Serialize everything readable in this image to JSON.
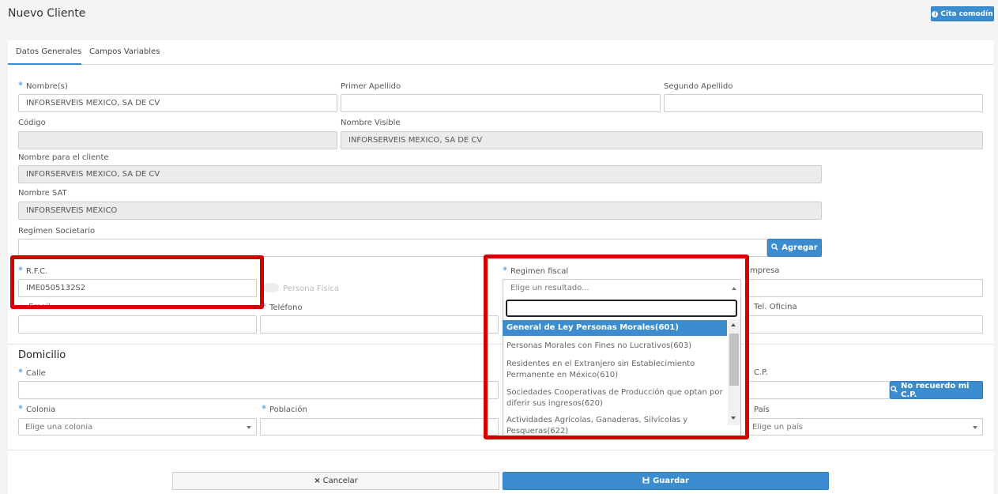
{
  "header": {
    "title": "Nuevo Cliente",
    "cita_label": "Cita comodín"
  },
  "tabs": [
    {
      "label": "Datos Generales",
      "active": true
    },
    {
      "label": "Campos Variables",
      "active": false
    }
  ],
  "fields": {
    "nombre": {
      "label": "Nombre(s)",
      "value": "INFORSERVEIS MEXICO, SA DE CV"
    },
    "primer_apellido": {
      "label": "Primer Apellido",
      "value": ""
    },
    "segundo_apellido": {
      "label": "Segundo Apellido",
      "value": ""
    },
    "codigo": {
      "label": "Código",
      "value": ""
    },
    "nombre_visible": {
      "label": "Nombre Visible",
      "value": "INFORSERVEIS MEXICO, SA DE CV"
    },
    "nombre_cliente": {
      "label": "Nombre para el cliente",
      "value": "INFORSERVEIS MEXICO, SA DE CV"
    },
    "nombre_sat": {
      "label": "Nombre SAT",
      "value": "INFORSERVEIS MEXICO"
    },
    "regimen_societario": {
      "label": "Regímen Societario",
      "value": "",
      "button": "Agregar"
    },
    "rfc": {
      "label": "R.F.C.",
      "value": "IME0505132S2"
    },
    "persona_fisica": {
      "label": "Persona Física"
    },
    "regimen_fiscal": {
      "label": "Regimen fiscal",
      "placeholder": "Elige un resultado..."
    },
    "empresa": {
      "label_fragment": "mpresa",
      "value": ""
    },
    "email": {
      "label_fragment": "Email",
      "value": ""
    },
    "telefono": {
      "label": "Teléfono",
      "value": ""
    },
    "tel_oficina": {
      "label": "Tel. Oficina",
      "value": ""
    }
  },
  "domicilio": {
    "title": "Domicilio",
    "calle": {
      "label": "Calle",
      "value": ""
    },
    "cp": {
      "label": "C.P.",
      "button": "No recuerdo mi C.P."
    },
    "colonia": {
      "label": "Colonia",
      "placeholder": "Elige una colonia"
    },
    "poblacion": {
      "label": "Población",
      "value": ""
    },
    "pais": {
      "label": "País",
      "placeholder": "Elige un país"
    }
  },
  "dropdown_options": [
    "General de Ley Personas Morales(601)",
    "Personas Morales con Fines no Lucrativos(603)",
    "Residentes en el Extranjero sin Establecimiento Permanente en México(610)",
    "Sociedades Cooperativas de Producción que optan por diferir sus ingresos(620)",
    "Actividades Agrícolas, Ganaderas, Silvícolas y Pesqueras(622)"
  ],
  "footer": {
    "cancel": "Cancelar",
    "save": "Guardar"
  },
  "colors": {
    "accent": "#3c8dcf",
    "highlight": "#d40000"
  }
}
